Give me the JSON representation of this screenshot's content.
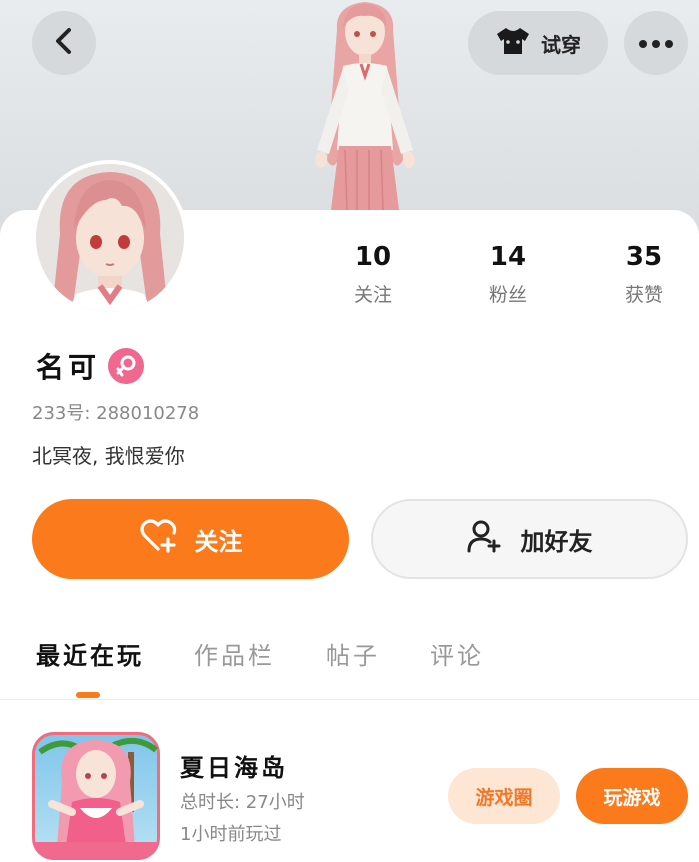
{
  "header": {
    "tryon_label": "试穿"
  },
  "profile": {
    "name": "名可",
    "uid": "233号: 288010278",
    "bio": "北冥夜, 我恨爱你"
  },
  "stats": [
    {
      "value": "10",
      "label": "关注"
    },
    {
      "value": "14",
      "label": "粉丝"
    },
    {
      "value": "35",
      "label": "获赞"
    }
  ],
  "actions": {
    "follow_label": "关注",
    "add_friend_label": "加好友"
  },
  "tabs": [
    {
      "label": "最近在玩",
      "active": true
    },
    {
      "label": "作品栏",
      "active": false
    },
    {
      "label": "帖子",
      "active": false
    },
    {
      "label": "评论",
      "active": false
    }
  ],
  "recent_game": {
    "title": "夏日海岛",
    "total_time": "总时长: 27小时",
    "last_played": "1小时前玩过",
    "circle_label": "游戏圈",
    "play_label": "玩游戏"
  },
  "colors": {
    "accent": "#fb7a1c",
    "gender_badge": "#f0688e",
    "circle_button_bg": "#fde6d4"
  },
  "icons": {
    "back": "chevron-left-icon",
    "shirt": "tshirt-icon",
    "more": "more-dots-icon",
    "gender": "female-icon",
    "follow": "heart-plus-icon",
    "add_friend": "user-plus-icon"
  }
}
